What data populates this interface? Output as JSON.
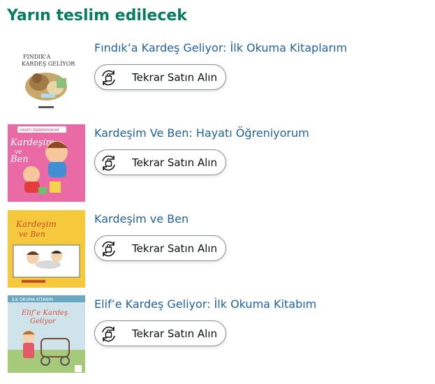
{
  "section": {
    "title": "Yarın teslim edilecek"
  },
  "items": [
    {
      "title": "Fındık’a Kardeş Geliyor: İlk Okuma Kitaplarım",
      "button_label": "Tekrar Satın Alın",
      "cover_text": [
        "FINDIK’A",
        "KARDEŞ GELİYOR"
      ]
    },
    {
      "title": "Kardeşim Ve Ben: Hayatı Öğreniyorum",
      "button_label": "Tekrar Satın Alın",
      "cover_text": [
        "HAYATI ÖĞRENİYORUM",
        "Kardeşim",
        "ve",
        "Ben"
      ]
    },
    {
      "title": "Kardeşim ve Ben",
      "button_label": "Tekrar Satın Alın",
      "cover_text": [
        "Kardeşim",
        "ve Ben"
      ]
    },
    {
      "title": "Elif’e Kardeş Geliyor: İlk Okuma Kitabım",
      "button_label": "Tekrar Satın Alın",
      "cover_text": [
        "İLK OKUMA KİTABIM",
        "Elif’e Kardeş",
        "Geliyor"
      ]
    }
  ],
  "colors": {
    "heading": "#067d62",
    "link": "#2162a1",
    "button_border": "#888c8c",
    "button_text": "#0f1111"
  },
  "icons": {
    "buy_again": "buy-again-icon"
  }
}
